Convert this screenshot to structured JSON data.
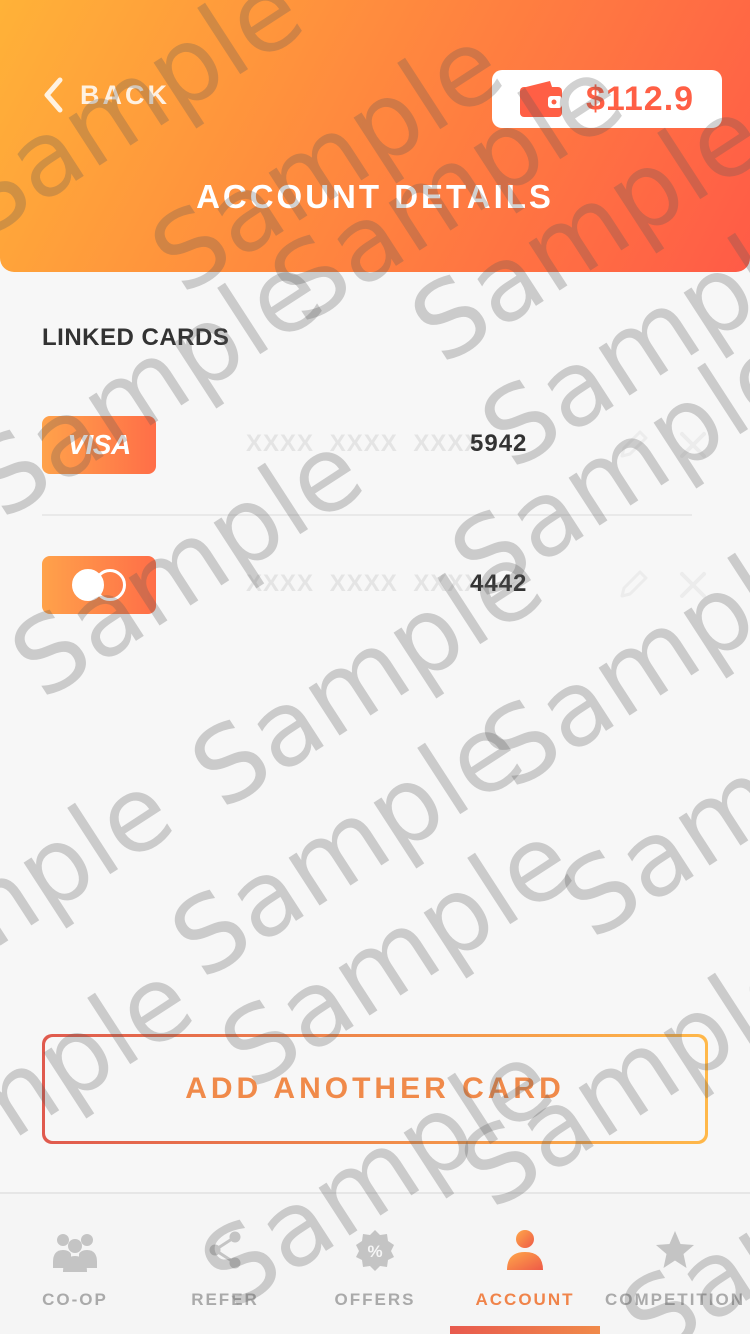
{
  "header": {
    "back_label": "BACK",
    "balance": "$112.9",
    "title": "ACCOUNT DETAILS"
  },
  "linked_cards": {
    "title": "LINKED CARDS",
    "cards": [
      {
        "brand": "VISA",
        "mask": "XXXX XXXX XXXX",
        "last4": "5942"
      },
      {
        "brand": "mastercard",
        "mask": "XXXX XXXX XXXX",
        "last4": "4442"
      }
    ]
  },
  "add_card_label": "ADD ANOTHER CARD",
  "tabs": [
    {
      "label": "CO-OP",
      "icon": "group-icon"
    },
    {
      "label": "REFER",
      "icon": "share-icon"
    },
    {
      "label": "OFFERS",
      "icon": "discount-badge-icon"
    },
    {
      "label": "ACCOUNT",
      "icon": "user-icon",
      "active": true
    },
    {
      "label": "COMPETITION",
      "icon": "star-icon"
    }
  ],
  "watermark_text": "Sample",
  "colors": {
    "accent": "#f0844a",
    "gradient_start": "#ffb238",
    "gradient_end": "#ff5b47",
    "balance_text": "#ff5f45"
  }
}
